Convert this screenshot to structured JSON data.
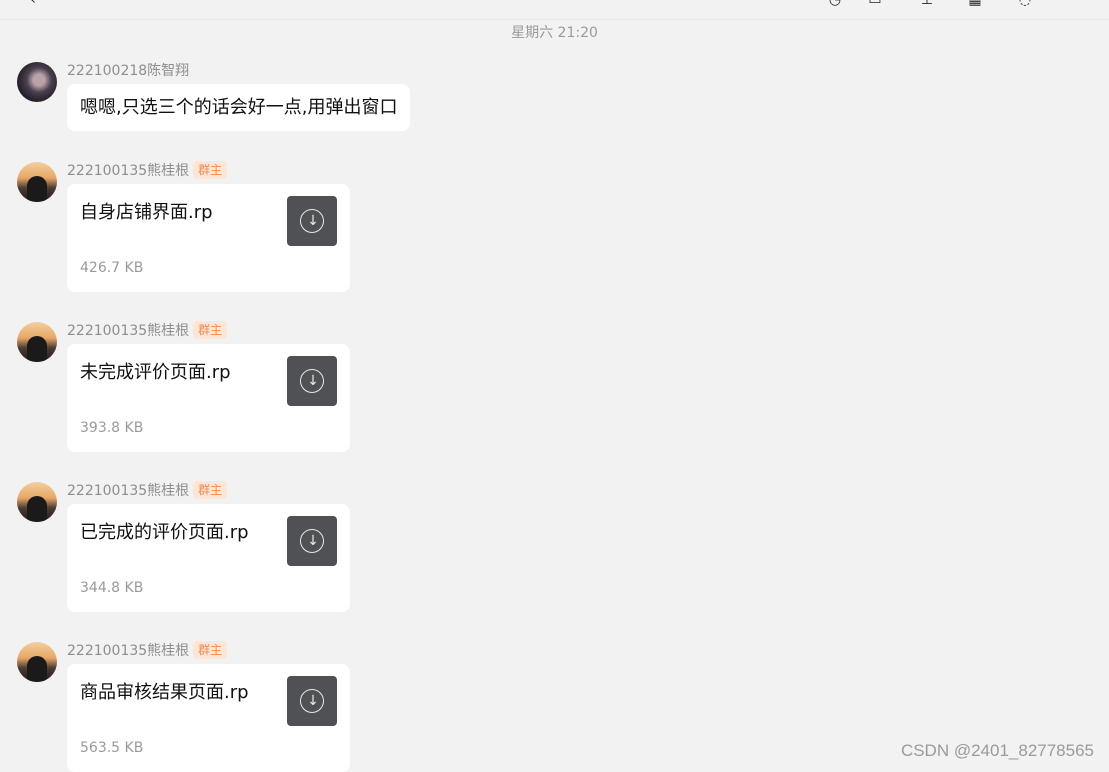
{
  "timestamp": "星期六 21:20",
  "messages": [
    {
      "sender": "222100218陈智翔",
      "text": "嗯嗯,只选三个的话会好一点,用弹出窗口"
    },
    {
      "sender": "222100135熊桂根",
      "badge": "群主",
      "file": {
        "name": "自身店铺界面.rp",
        "size": "426.7 KB"
      }
    },
    {
      "sender": "222100135熊桂根",
      "badge": "群主",
      "file": {
        "name": "未完成评价页面.rp",
        "size": "393.8 KB"
      }
    },
    {
      "sender": "222100135熊桂根",
      "badge": "群主",
      "file": {
        "name": "已完成的评价页面.rp",
        "size": "344.8 KB"
      }
    },
    {
      "sender": "222100135熊桂根",
      "badge": "群主",
      "file": {
        "name": "商品审核结果页面.rp",
        "size": "563.5 KB"
      }
    }
  ],
  "watermark": "CSDN @2401_82778565",
  "colors": {
    "background": "#f2f2f2",
    "bubble": "#ffffff",
    "badge_bg": "#fde6d8",
    "badge_text": "#f28a4a",
    "download_button": "#505154"
  },
  "icons": [
    "back-icon",
    "phone-icon",
    "screen-share-icon",
    "upload-icon",
    "apps-icon",
    "search-icon",
    "download-icon"
  ]
}
